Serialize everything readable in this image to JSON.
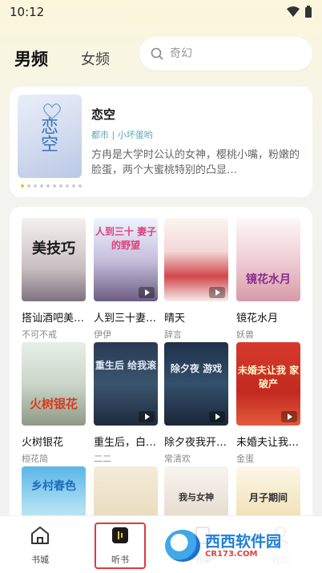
{
  "status": {
    "time": "10:12"
  },
  "header": {
    "tab_male": "男频",
    "tab_female": "女频",
    "search_placeholder": "奇幻"
  },
  "banner": {
    "title": "恋空",
    "tags": "都市 | 小坏蛋哟",
    "description": "方冉是大学时公认的女神，樱桃小嘴，粉嫩的脸蛋，两个大蜜桃特别的凸显…",
    "cover_text": "恋空",
    "dots": 10,
    "active_dot": 0
  },
  "books": [
    {
      "name": "搭讪酒吧美…",
      "author": "不可不戒",
      "cover_text": "美技巧"
    },
    {
      "name": "人到三十妻…",
      "author": "伊伊",
      "cover_text": "人到三十 妻子的野望"
    },
    {
      "name": "晴天",
      "author": "辞言",
      "cover_text": ""
    },
    {
      "name": "镜花水月",
      "author": "妖兽",
      "cover_text": "镜花水月"
    },
    {
      "name": "火树银花",
      "author": "桓花简",
      "cover_text": "火树银花"
    },
    {
      "name": "重生后，白…",
      "author": "二二",
      "cover_text": "重生后 给我滚"
    },
    {
      "name": "除夕夜我开…",
      "author": "常清欢",
      "cover_text": "除夕夜 游戏"
    },
    {
      "name": "未婚夫让我…",
      "author": "金蛋",
      "cover_text": "未婚夫让我 家破产"
    },
    {
      "name": "",
      "author": "",
      "cover_text": "乡村春色"
    },
    {
      "name": "",
      "author": "",
      "cover_text": ""
    },
    {
      "name": "",
      "author": "",
      "cover_text": "我与女神"
    },
    {
      "name": "",
      "author": "",
      "cover_text": "月子期间"
    }
  ],
  "tabbar": {
    "bookstore": "书城",
    "listen": "听书",
    "shelf": "书架",
    "mine": "我的"
  },
  "watermark": {
    "text": "西西软件园",
    "sub": "CR173.COM"
  },
  "colors": {
    "accent": "#f2c01e",
    "highlight": "#e0393e",
    "tag": "#5aa7b5"
  }
}
